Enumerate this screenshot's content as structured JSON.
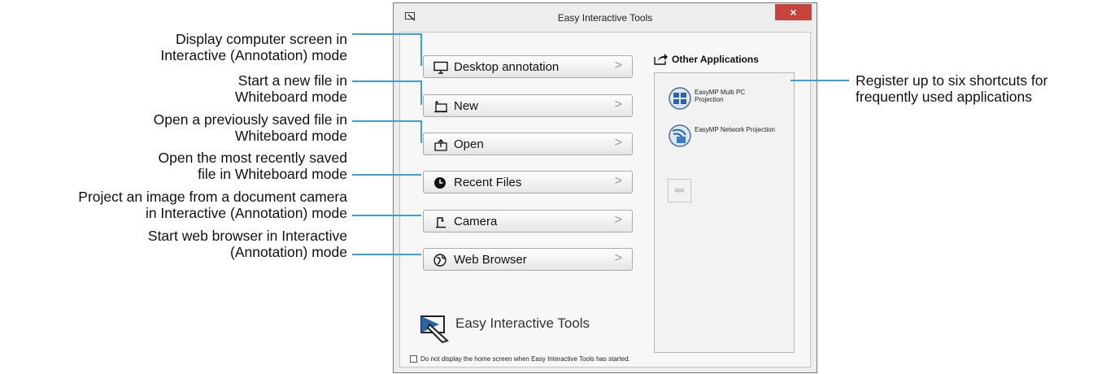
{
  "window": {
    "title": "Easy Interactive Tools",
    "close_label": "×"
  },
  "buttons": [
    {
      "label": "Desktop annotation",
      "icon": "monitor-icon"
    },
    {
      "label": "New",
      "icon": "new-whiteboard-icon"
    },
    {
      "label": "Open",
      "icon": "open-folder-icon"
    },
    {
      "label": "Recent Files",
      "icon": "clock-icon"
    },
    {
      "label": "Camera",
      "icon": "document-camera-icon"
    },
    {
      "label": "Web Browser",
      "icon": "globe-icon"
    }
  ],
  "chevron": ">",
  "other_apps": {
    "header": "Other Applications",
    "items": [
      {
        "label_line1": "EasyMP Multi PC",
        "label_line2": "Projection",
        "icon": "multi-pc-icon"
      },
      {
        "label_line1": "EasyMP Network Projection",
        "label_line2": "",
        "icon": "network-projection-icon"
      }
    ],
    "empty_slot": "app"
  },
  "brand": {
    "text": "Easy Interactive Tools"
  },
  "checkbox": {
    "label": "Do not display the home screen when Easy Interactive Tools has started.",
    "checked": false
  },
  "callouts": {
    "left": [
      {
        "line1": "Display computer screen in",
        "line2": "Interactive (Annotation) mode"
      },
      {
        "line1": "Start a new file in",
        "line2": "Whiteboard mode"
      },
      {
        "line1": "Open a previously saved file in",
        "line2": "Whiteboard mode"
      },
      {
        "line1": "Open the most recently saved",
        "line2": "file in Whiteboard mode"
      },
      {
        "line1": "Project an image from a document camera",
        "line2": "in Interactive (Annotation) mode"
      },
      {
        "line1": "Start web browser in Interactive",
        "line2": "(Annotation) mode"
      }
    ],
    "right": {
      "line1": "Register up to six shortcuts for",
      "line2": "frequently used applications"
    }
  },
  "colors": {
    "leader": "#3ba0d8",
    "close": "#c7443a"
  }
}
